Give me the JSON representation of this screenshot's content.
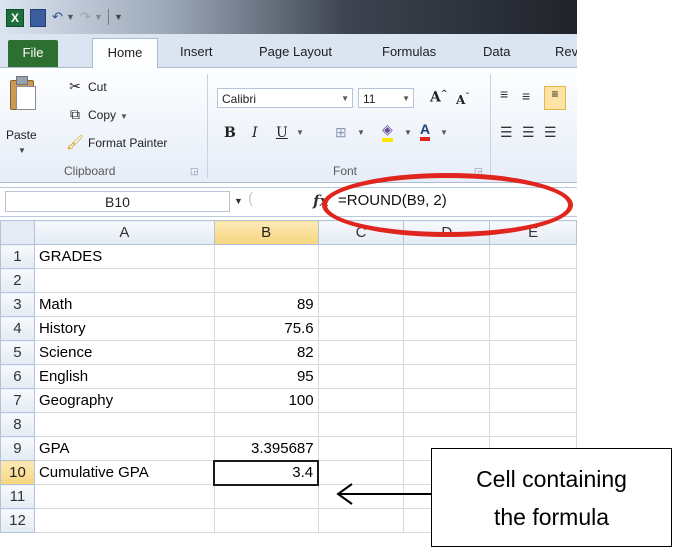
{
  "quick_access": {
    "app_icon": "excel-icon",
    "save_icon": "save-icon",
    "undo_icon": "undo-icon",
    "redo_icon": "redo-icon",
    "customize_icon": "customize-quick-access-icon"
  },
  "tabs": [
    "File",
    "Home",
    "Insert",
    "Page Layout",
    "Formulas",
    "Data",
    "Rev"
  ],
  "ribbon": {
    "clipboard": {
      "paste": "Paste",
      "cut": "Cut",
      "copy": "Copy",
      "format_painter": "Format Painter",
      "group_label": "Clipboard"
    },
    "font": {
      "font_name": "Calibri",
      "font_size": "11",
      "group_label": "Font"
    }
  },
  "formula_bar": {
    "name_box": "B10",
    "formula": "=ROUND(B9, 2)"
  },
  "columns": [
    "A",
    "B",
    "C",
    "D",
    "E"
  ],
  "rows": [
    {
      "num": "1",
      "a": "GRADES",
      "b": ""
    },
    {
      "num": "2",
      "a": "",
      "b": ""
    },
    {
      "num": "3",
      "a": "Math",
      "b": "89"
    },
    {
      "num": "4",
      "a": "History",
      "b": "75.6"
    },
    {
      "num": "5",
      "a": "Science",
      "b": "82"
    },
    {
      "num": "6",
      "a": "English",
      "b": "95"
    },
    {
      "num": "7",
      "a": "Geography",
      "b": "100"
    },
    {
      "num": "8",
      "a": "",
      "b": ""
    },
    {
      "num": "9",
      "a": "GPA",
      "b": "3.395687"
    },
    {
      "num": "10",
      "a": "Cumulative GPA",
      "b": "3.4"
    },
    {
      "num": "11",
      "a": "",
      "b": ""
    },
    {
      "num": "12",
      "a": "",
      "b": ""
    }
  ],
  "annotation": {
    "line1": "Cell containing",
    "line2": "the formula"
  },
  "colors": {
    "highlight_ellipse": "#e0241e",
    "file_tab": "#2c6f30",
    "selected_header": "#f7d57e"
  }
}
